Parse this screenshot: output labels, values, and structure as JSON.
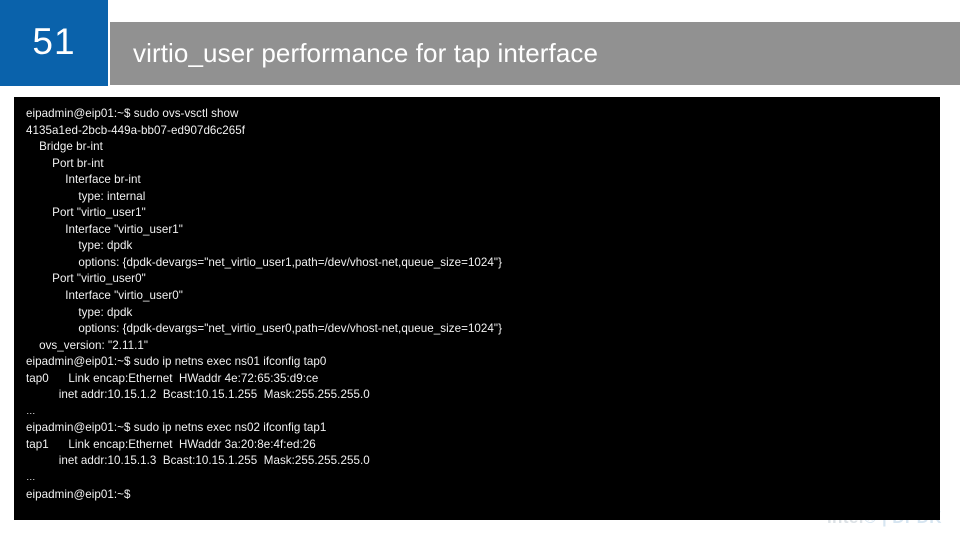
{
  "slide": {
    "number": "51",
    "title": "virtio_user performance for tap interface",
    "accent_blue": "#0a62ab",
    "band_gray": "#919191",
    "terminal_bg": "#000000",
    "terminal_fg": "#f2f2f2"
  },
  "watermark": {
    "text_plain": "Intel",
    "text_accent": "® | DPDK",
    "full": "Intel® | DPDK"
  },
  "terminal": {
    "lines": [
      "eipadmin@eip01:~$ sudo ovs-vsctl show",
      "4135a1ed-2bcb-449a-bb07-ed907d6c265f",
      "    Bridge br-int",
      "        Port br-int",
      "            Interface br-int",
      "                type: internal",
      "        Port \"virtio_user1\"",
      "            Interface \"virtio_user1\"",
      "                type: dpdk",
      "                options: {dpdk-devargs=\"net_virtio_user1,path=/dev/vhost-net,queue_size=1024\"}",
      "        Port \"virtio_user0\"",
      "            Interface \"virtio_user0\"",
      "                type: dpdk",
      "                options: {dpdk-devargs=\"net_virtio_user0,path=/dev/vhost-net,queue_size=1024\"}",
      "    ovs_version: \"2.11.1\"",
      "eipadmin@eip01:~$ sudo ip netns exec ns01 ifconfig tap0",
      "tap0      Link encap:Ethernet  HWaddr 4e:72:65:35:d9:ce",
      "          inet addr:10.15.1.2  Bcast:10.15.1.255  Mask:255.255.255.0",
      "…",
      "eipadmin@eip01:~$ sudo ip netns exec ns02 ifconfig tap1",
      "tap1      Link encap:Ethernet  HWaddr 3a:20:8e:4f:ed:26",
      "          inet addr:10.15.1.3  Bcast:10.15.1.255  Mask:255.255.255.0",
      "…",
      "eipadmin@eip01:~$"
    ]
  }
}
